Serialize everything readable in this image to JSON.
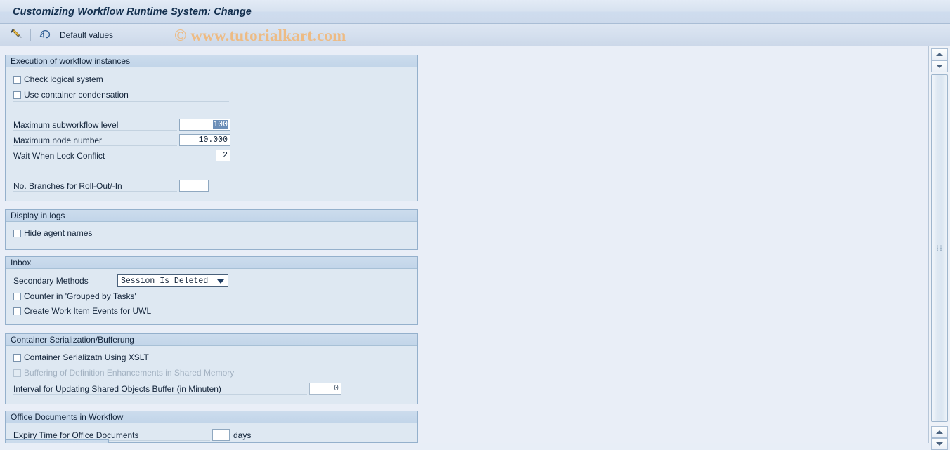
{
  "window": {
    "title": "Customizing Workflow Runtime System: Change"
  },
  "toolbar": {
    "edit_icon": "pencil-toggle-display-change-icon",
    "default_values_icon": "undo-arrow-icon",
    "default_values_label": "Default values",
    "watermark": "© www.tutorialkart.com"
  },
  "sections": {
    "execution": {
      "header": "Execution of workflow instances",
      "check_logical_system": {
        "label": "Check logical system",
        "checked": false
      },
      "use_container_condensation": {
        "label": "Use container condensation",
        "checked": false
      },
      "max_subworkflow_level": {
        "label": "Maximum subworkflow level",
        "value": "100",
        "selected": true
      },
      "max_node_number": {
        "label": "Maximum node number",
        "value": "10.000"
      },
      "wait_when_lock_conflict": {
        "label": "Wait When Lock Conflict",
        "value": "2"
      },
      "branches_rollout": {
        "label": "No. Branches for Roll-Out/-In",
        "value": ""
      }
    },
    "display_logs": {
      "header": "Display in logs",
      "hide_agent_names": {
        "label": "Hide agent names",
        "checked": false
      }
    },
    "inbox": {
      "header": "Inbox",
      "secondary_methods": {
        "label": "Secondary Methods",
        "value": "Session Is Deleted",
        "options": [
          "Session Is Deleted"
        ]
      },
      "counter_grouped": {
        "label": "Counter in 'Grouped by Tasks'",
        "checked": false
      },
      "create_work_item_events": {
        "label": "Create Work Item Events for UWL",
        "checked": false
      }
    },
    "container_serialization": {
      "header": "Container Serialization/Bufferung",
      "container_serializatn_xslt": {
        "label": "Container Serializatn Using XSLT",
        "checked": false,
        "disabled": false
      },
      "buffering_definition": {
        "label": "Buffering of Definition Enhancements in Shared Memory",
        "checked": false,
        "disabled": true
      },
      "interval_updating": {
        "label": "Interval for Updating Shared Objects Buffer (in Minuten)",
        "value": "0"
      }
    },
    "office_documents": {
      "header": "Office Documents in Workflow",
      "expiry_time": {
        "label": "Expiry Time for Office Documents",
        "value": "",
        "unit": "days"
      }
    }
  },
  "scrollbar": {
    "up_icon": "scroll-up-arrow-icon",
    "down_icon": "scroll-down-arrow-icon",
    "bottom_up_icon": "scroll-up-arrow-icon",
    "bottom_down_icon": "scroll-down-arrow-icon"
  },
  "colors": {
    "page_background": "#e9eef7",
    "panel_background": "#dee8f2",
    "panel_header": "#c6d8ea",
    "panel_border": "#94b0cc",
    "selection": "#6d8fb8",
    "watermark": "#edbb84",
    "title_text": "#14304f"
  }
}
